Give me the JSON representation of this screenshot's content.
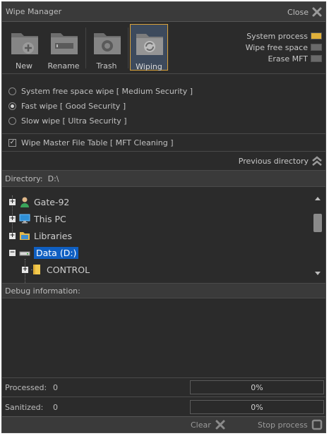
{
  "window": {
    "title": "Wipe Manager",
    "close_label": "Close"
  },
  "toolbar": {
    "buttons": [
      {
        "label": "New",
        "icon": "folder-plus-icon"
      },
      {
        "label": "Rename",
        "icon": "folder-rename-icon"
      },
      {
        "label": "Trash",
        "icon": "trash-folder-icon"
      },
      {
        "label": "Wiping",
        "icon": "wipe-folder-icon",
        "active": true
      }
    ]
  },
  "status": [
    {
      "label": "System process",
      "color": "#e0b03a"
    },
    {
      "label": "Wipe free space",
      "color": "#6a6a6a"
    },
    {
      "label": "Erase MFT",
      "color": "#6a6a6a"
    }
  ],
  "options": {
    "modes": [
      {
        "label": "System free space wipe [ Medium Security ]",
        "selected": false
      },
      {
        "label": "Fast wipe [ Good Security ]",
        "selected": true
      },
      {
        "label": "Slow wipe [ Ultra Security ]",
        "selected": false
      }
    ],
    "mft": {
      "label": "Wipe Master File Table [ MFT Cleaning ]",
      "checked": true
    }
  },
  "navigation": {
    "previous_directory": "Previous directory"
  },
  "directory": {
    "label": "Directory:",
    "value": "D:\\"
  },
  "tree": [
    {
      "label": "Gate-92",
      "icon": "user-icon"
    },
    {
      "label": "This PC",
      "icon": "computer-icon"
    },
    {
      "label": "Libraries",
      "icon": "libraries-folder-icon"
    },
    {
      "label": "Data (D:)",
      "icon": "drive-icon",
      "selected": true
    },
    {
      "label": "CONTROL",
      "icon": "folder-icon"
    }
  ],
  "debug": {
    "label": "Debug information:"
  },
  "stats": {
    "processed": {
      "label": "Processed:",
      "value": "0",
      "percent": "0%"
    },
    "sanitized": {
      "label": "Sanitized:",
      "value": "0",
      "percent": "0%"
    }
  },
  "footer": {
    "clear_label": "Clear",
    "stop_label": "Stop process"
  }
}
